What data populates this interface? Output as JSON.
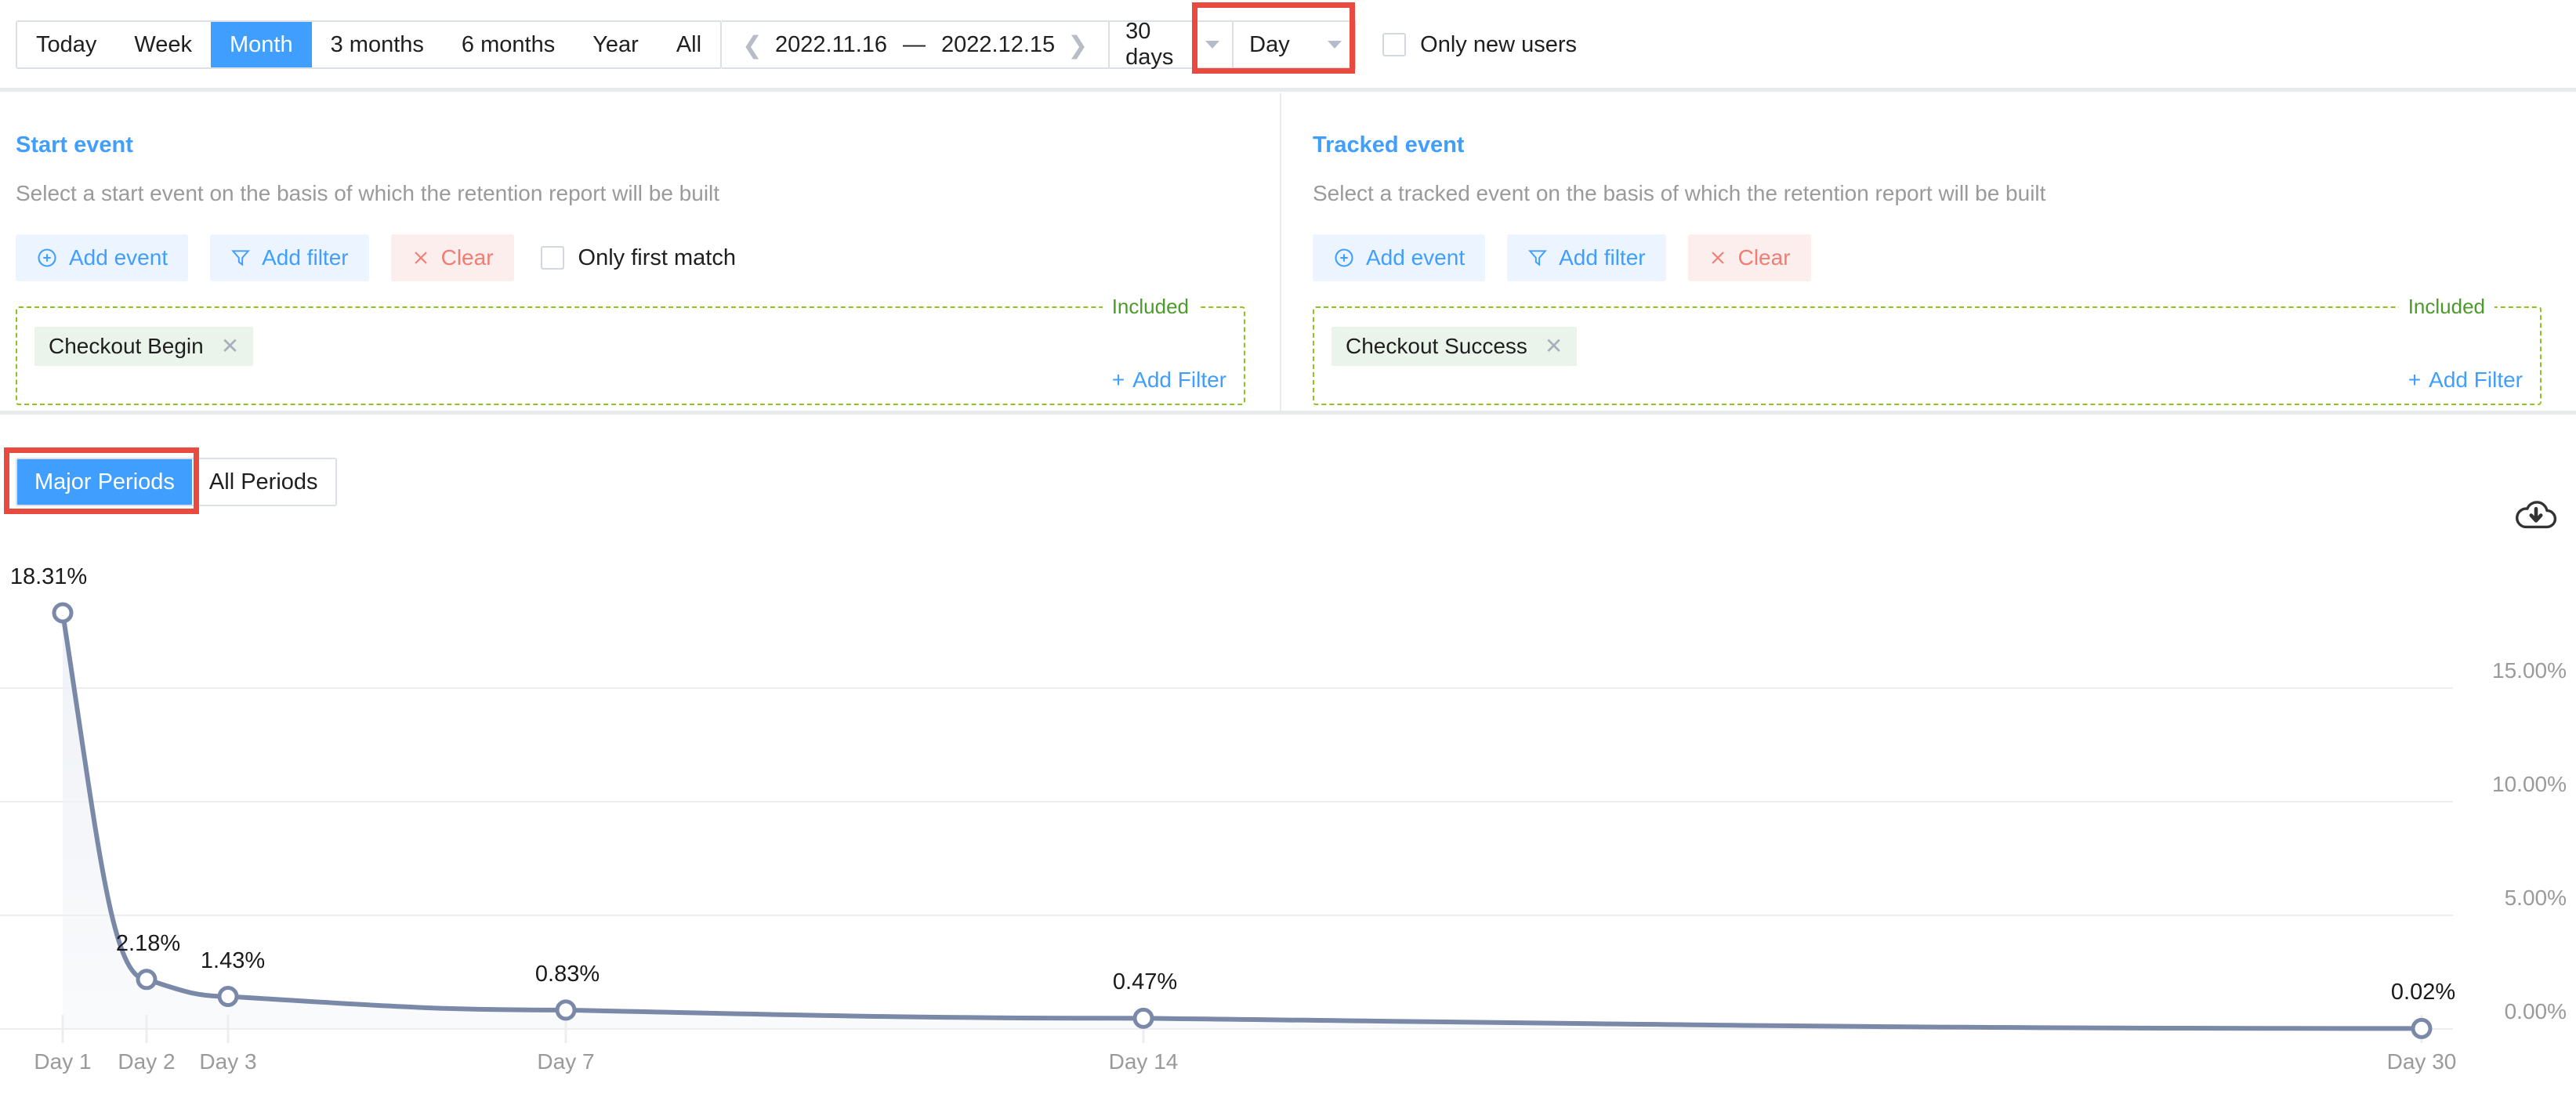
{
  "toolbar": {
    "ranges": [
      {
        "label": "Today",
        "active": false
      },
      {
        "label": "Week",
        "active": false
      },
      {
        "label": "Month",
        "active": true
      },
      {
        "label": "3 months",
        "active": false
      },
      {
        "label": "6 months",
        "active": false
      },
      {
        "label": "Year",
        "active": false
      },
      {
        "label": "All",
        "active": false
      }
    ],
    "prev_icon": "chevron-left-icon",
    "next_icon": "chevron-right-icon",
    "date_start": "2022.11.16",
    "date_dash": "—",
    "date_end": "2022.12.15",
    "window_select": "30 days",
    "granularity_select": "Day",
    "only_new_users_label": "Only new users",
    "only_new_users_checked": false,
    "highlight_color": "#e84a3f",
    "accent_color": "#409eff"
  },
  "start_event": {
    "title": "Start event",
    "subtitle": "Select a start event on the basis of which the retention report will be built",
    "add_event_label": "Add event",
    "add_filter_label": "Add filter",
    "clear_label": "Clear",
    "only_first_match_label": "Only first match",
    "only_first_match_checked": false,
    "included_label": "Included",
    "tag_label": "Checkout Begin",
    "add_filter_link": "Add Filter",
    "plus": "+"
  },
  "tracked_event": {
    "title": "Tracked event",
    "subtitle": "Select a tracked event on the basis of which the retention report will be built",
    "add_event_label": "Add event",
    "add_filter_label": "Add filter",
    "clear_label": "Clear",
    "included_label": "Included",
    "tag_label": "Checkout Success",
    "add_filter_link": "Add Filter",
    "plus": "+"
  },
  "period_tabs": [
    {
      "label": "Major Periods",
      "active": true
    },
    {
      "label": "All Periods",
      "active": false
    }
  ],
  "download": {
    "icon": "cloud-download-icon"
  },
  "chart_data": {
    "type": "line",
    "title": "",
    "xlabel": "",
    "ylabel": "",
    "categories": [
      "Day 1",
      "Day 2",
      "Day 3",
      "Day 7",
      "Day 14",
      "Day 30"
    ],
    "values": [
      18.31,
      2.18,
      1.43,
      0.83,
      0.47,
      0.02
    ],
    "point_labels": [
      "18.31%",
      "2.18%",
      "1.43%",
      "0.83%",
      "0.47%",
      "0.02%"
    ],
    "ytick_labels": [
      "15.00%",
      "10.00%",
      "5.00%",
      "0.00%"
    ],
    "yticks": [
      15,
      10,
      5,
      0
    ],
    "ylim": [
      0,
      20
    ],
    "grid": true,
    "legend": "none",
    "line_color": "#7b89a8",
    "point_fill": "#ffffff",
    "area_fill": "#eef1f6"
  }
}
